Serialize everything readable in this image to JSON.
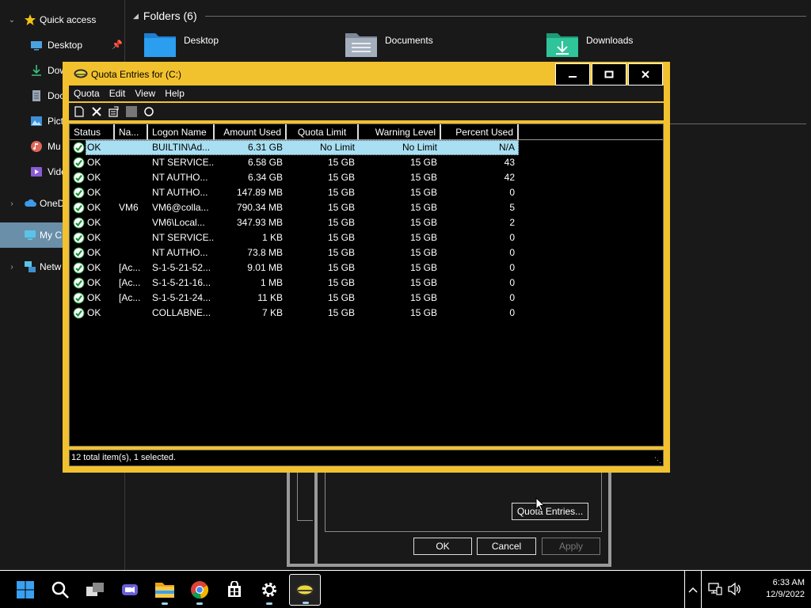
{
  "explorer": {
    "nav": {
      "quick_access": "Quick access",
      "items": [
        {
          "label": "Desktop",
          "icon": "desktop-icon"
        },
        {
          "label": "Dow",
          "icon": "download-icon"
        },
        {
          "label": "Doc",
          "icon": "document-icon"
        },
        {
          "label": "Pict",
          "icon": "pictures-icon"
        },
        {
          "label": "Mu",
          "icon": "music-icon"
        },
        {
          "label": "Vide",
          "icon": "videos-icon"
        }
      ],
      "onedrive": "OneD",
      "this_pc": "My C",
      "network": "Netw"
    },
    "folders_header": "Folders (6)",
    "folders": [
      {
        "label": "Desktop"
      },
      {
        "label": "Documents"
      },
      {
        "label": "Downloads"
      }
    ],
    "bg_dialog": {
      "quota_entries_button": "Quota Entries...",
      "ok": "OK",
      "cancel": "Cancel",
      "apply": "Apply"
    }
  },
  "quota_window": {
    "title": "Quota Entries for  (C:)",
    "menu": [
      "Quota",
      "Edit",
      "View",
      "Help"
    ],
    "columns": [
      "Status",
      "Na...",
      "Logon Name",
      "Amount Used",
      "Quota Limit",
      "Warning Level",
      "Percent Used"
    ],
    "rows": [
      {
        "status": "OK",
        "name": "",
        "logon": "BUILTIN\\Ad...",
        "amount": "6.31 GB",
        "limit": "No Limit",
        "warning": "No Limit",
        "percent": "N/A",
        "selected": true
      },
      {
        "status": "OK",
        "name": "",
        "logon": "NT SERVICE...",
        "amount": "6.58 GB",
        "limit": "15 GB",
        "warning": "15 GB",
        "percent": "43"
      },
      {
        "status": "OK",
        "name": "",
        "logon": "NT AUTHO...",
        "amount": "6.34 GB",
        "limit": "15 GB",
        "warning": "15 GB",
        "percent": "42"
      },
      {
        "status": "OK",
        "name": "",
        "logon": "NT AUTHO...",
        "amount": "147.89 MB",
        "limit": "15 GB",
        "warning": "15 GB",
        "percent": "0"
      },
      {
        "status": "OK",
        "name": "VM6",
        "logon": "VM6@colla...",
        "amount": "790.34 MB",
        "limit": "15 GB",
        "warning": "15 GB",
        "percent": "5"
      },
      {
        "status": "OK",
        "name": "",
        "logon": "VM6\\Local...",
        "amount": "347.93 MB",
        "limit": "15 GB",
        "warning": "15 GB",
        "percent": "2"
      },
      {
        "status": "OK",
        "name": "",
        "logon": "NT SERVICE...",
        "amount": "1 KB",
        "limit": "15 GB",
        "warning": "15 GB",
        "percent": "0"
      },
      {
        "status": "OK",
        "name": "",
        "logon": "NT AUTHO...",
        "amount": "73.8 MB",
        "limit": "15 GB",
        "warning": "15 GB",
        "percent": "0"
      },
      {
        "status": "OK",
        "name": "[Ac...",
        "logon": "S-1-5-21-52...",
        "amount": "9.01 MB",
        "limit": "15 GB",
        "warning": "15 GB",
        "percent": "0"
      },
      {
        "status": "OK",
        "name": "[Ac...",
        "logon": "S-1-5-21-16...",
        "amount": "1 MB",
        "limit": "15 GB",
        "warning": "15 GB",
        "percent": "0"
      },
      {
        "status": "OK",
        "name": "[Ac...",
        "logon": "S-1-5-21-24...",
        "amount": "11 KB",
        "limit": "15 GB",
        "warning": "15 GB",
        "percent": "0"
      },
      {
        "status": "OK",
        "name": "",
        "logon": "COLLABNE...",
        "amount": "7 KB",
        "limit": "15 GB",
        "warning": "15 GB",
        "percent": "0"
      }
    ],
    "status_text": "12 total item(s), 1 selected.",
    "accent": "#f2c12e"
  },
  "taskbar": {
    "apps": [
      "start-icon",
      "search-icon",
      "task-view-icon",
      "meet-icon",
      "file-explorer-icon",
      "chrome-icon",
      "store-icon",
      "settings-icon",
      "quota-app-icon"
    ],
    "time": "6:33 AM",
    "date": "12/9/2022"
  }
}
